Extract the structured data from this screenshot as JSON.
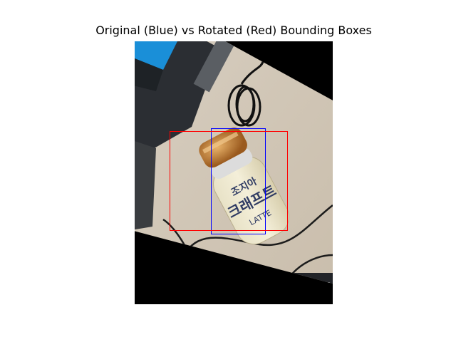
{
  "title": "Original (Blue) vs Rotated (Red) Bounding Boxes",
  "boxes": {
    "original_color": "#0000ff",
    "rotated_color": "#ff0000"
  },
  "label_text": {
    "cap_line1": "조지아",
    "cap_line2": "크래프트",
    "cap_line3": "LATTE"
  }
}
